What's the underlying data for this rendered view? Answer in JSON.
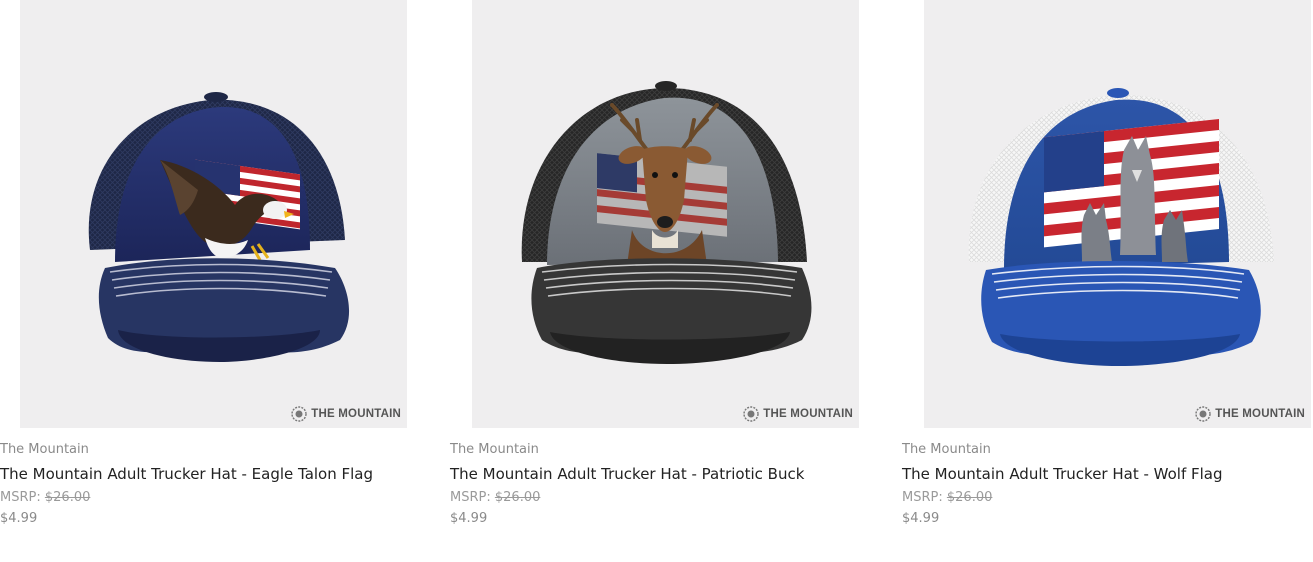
{
  "products": [
    {
      "brand": "The Mountain",
      "title": "The Mountain Adult Trucker Hat - Eagle Talon Flag",
      "msrp_label": "MSRP:",
      "msrp_value": "$26.00",
      "price": "$4.99",
      "logo_text": "THE MOUNTAIN",
      "icon": "eagle-flag-hat-image"
    },
    {
      "brand": "The Mountain",
      "title": "The Mountain Adult Trucker Hat - Patriotic Buck",
      "msrp_label": "MSRP:",
      "msrp_value": "$26.00",
      "price": "$4.99",
      "logo_text": "THE MOUNTAIN",
      "icon": "buck-hat-image"
    },
    {
      "brand": "The Mountain",
      "title": "The Mountain Adult Trucker Hat - Wolf Flag",
      "msrp_label": "MSRP:",
      "msrp_value": "$26.00",
      "price": "$4.99",
      "logo_text": "THE MOUNTAIN",
      "icon": "wolf-flag-hat-image"
    }
  ],
  "colors": {
    "image_bg": "#efeeef",
    "title": "#222222",
    "meta": "#8a8a8a"
  }
}
